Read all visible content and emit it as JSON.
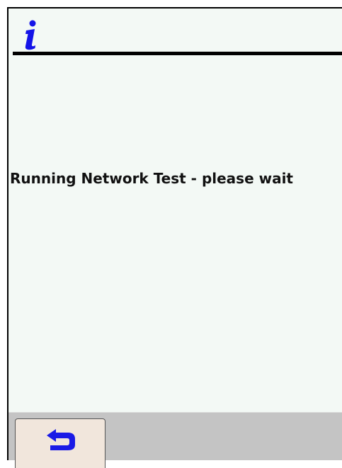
{
  "header": {
    "icon": "info-icon"
  },
  "main": {
    "message": "Running Network Test - please wait"
  },
  "footer": {
    "back_icon": "return-arrow-icon"
  },
  "colors": {
    "screen_background": "#f3f9f5",
    "info_icon": "#1414e8",
    "bottom_bar": "#c4c4c4",
    "button_background": "#f1e6dc",
    "back_icon": "#1a1ae6"
  }
}
